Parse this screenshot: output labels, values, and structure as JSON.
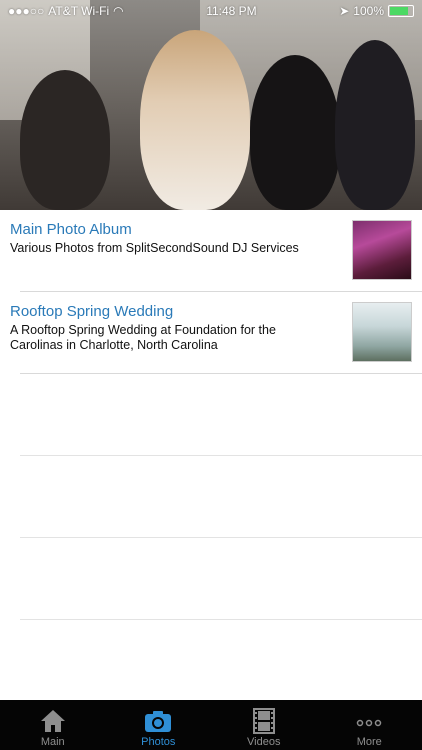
{
  "status_bar": {
    "carrier": "AT&T Wi-Fi",
    "time": "11:48 PM",
    "battery": "100%"
  },
  "albums": [
    {
      "title": "Main Photo Album",
      "description": "Various Photos from SplitSecondSound DJ Services"
    },
    {
      "title": "Rooftop Spring Wedding",
      "description": "A Rooftop Spring Wedding at Foundation for the Carolinas in Charlotte, North Carolina"
    }
  ],
  "tabs": [
    {
      "label": "Main",
      "icon": "home-icon"
    },
    {
      "label": "Photos",
      "icon": "camera-icon",
      "active": true
    },
    {
      "label": "Videos",
      "icon": "film-icon"
    },
    {
      "label": "More",
      "icon": "more-icon"
    }
  ],
  "colors": {
    "accent": "#2f8fd6",
    "title": "#2a7ab8",
    "tabbar": "#050505"
  }
}
